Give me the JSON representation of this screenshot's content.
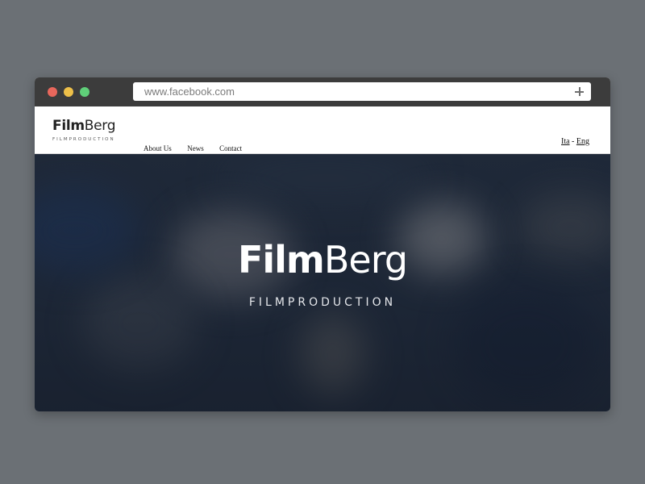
{
  "window": {
    "controls": [
      "close",
      "minimize",
      "maximize"
    ],
    "colors": {
      "close": "#e8675c",
      "minimize": "#eec049",
      "maximize": "#5fcf79"
    }
  },
  "addressbar": {
    "url": "www.facebook.com",
    "new_tab_icon": "plus-icon"
  },
  "site": {
    "logo": {
      "bold": "Film",
      "light": "Berg",
      "tagline": "FILMPRODUCTION"
    },
    "nav": [
      {
        "label": "About Us"
      },
      {
        "label": "News"
      },
      {
        "label": "Contact"
      }
    ],
    "language": {
      "ita": "Ita",
      "separator": " - ",
      "eng": "Eng"
    }
  },
  "hero": {
    "title_bold": "Film",
    "title_light": "Berg",
    "subtitle": "FILMPRODUCTION",
    "background_color": "#1f2939"
  }
}
